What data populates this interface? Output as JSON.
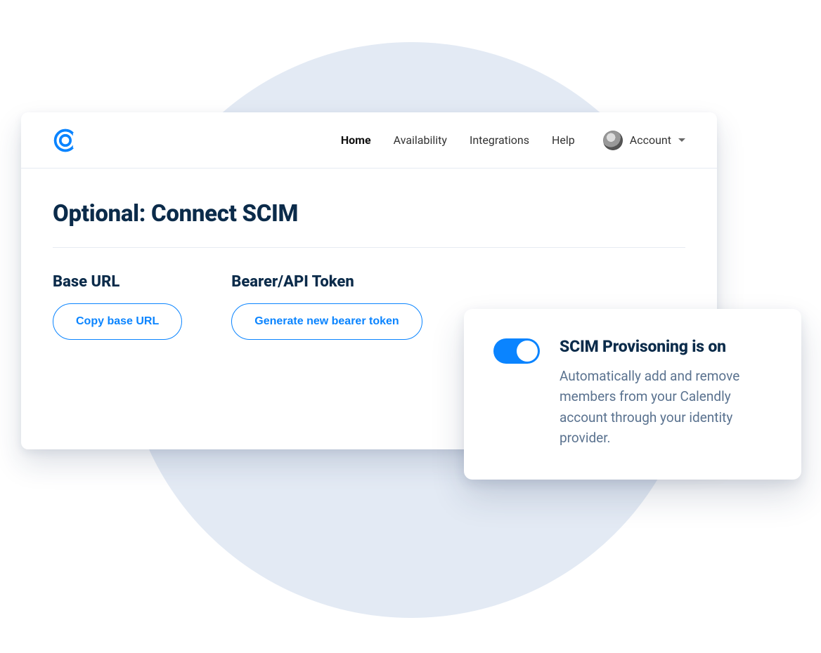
{
  "nav": {
    "items": [
      {
        "label": "Home",
        "active": true
      },
      {
        "label": "Availability",
        "active": false
      },
      {
        "label": "Integrations",
        "active": false
      },
      {
        "label": "Help",
        "active": false
      }
    ],
    "account_label": "Account"
  },
  "page": {
    "title": "Optional: Connect SCIM"
  },
  "sections": {
    "base_url": {
      "label": "Base URL",
      "button": "Copy base URL"
    },
    "bearer_token": {
      "label": "Bearer/API Token",
      "button": "Generate new bearer token"
    }
  },
  "toggle_card": {
    "on": true,
    "title": "SCIM Provisoning is on",
    "description": "Automatically add and remove members from your Calendly account through your identity provider."
  },
  "colors": {
    "primary": "#0a84ff",
    "heading": "#0b2b4a",
    "muted": "#5a728f",
    "circle_bg": "#e3eaf4"
  }
}
